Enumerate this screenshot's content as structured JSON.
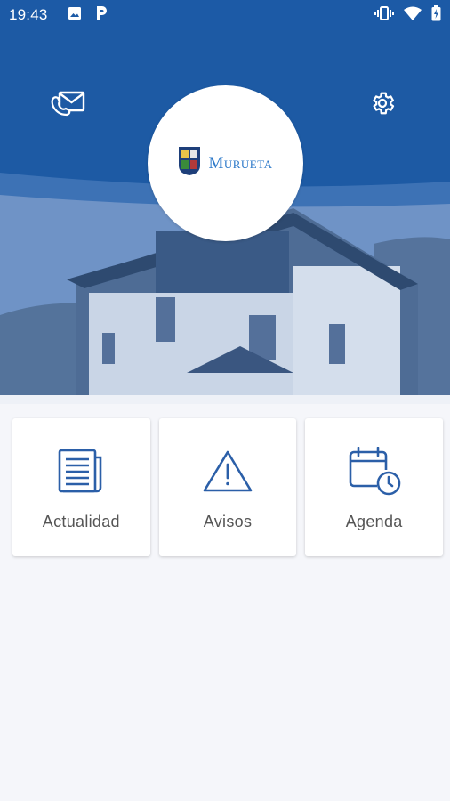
{
  "status_bar": {
    "time": "19:43",
    "left_icons": [
      "image-icon",
      "parking-icon"
    ],
    "right_icons": [
      "vibrate-icon",
      "wifi-icon",
      "battery-icon"
    ]
  },
  "header": {
    "logo_text": "Murueta",
    "mail_icon": "mail-phone-icon",
    "settings_icon": "gear-icon"
  },
  "cards": [
    {
      "label": "Actualidad",
      "icon": "newspaper-icon"
    },
    {
      "label": "Avisos",
      "icon": "warning-icon"
    },
    {
      "label": "Agenda",
      "icon": "calendar-clock-icon"
    }
  ],
  "colors": {
    "primary": "#1c5aa6",
    "icon_blue": "#2b5fa8",
    "background": "#f5f6fa"
  }
}
